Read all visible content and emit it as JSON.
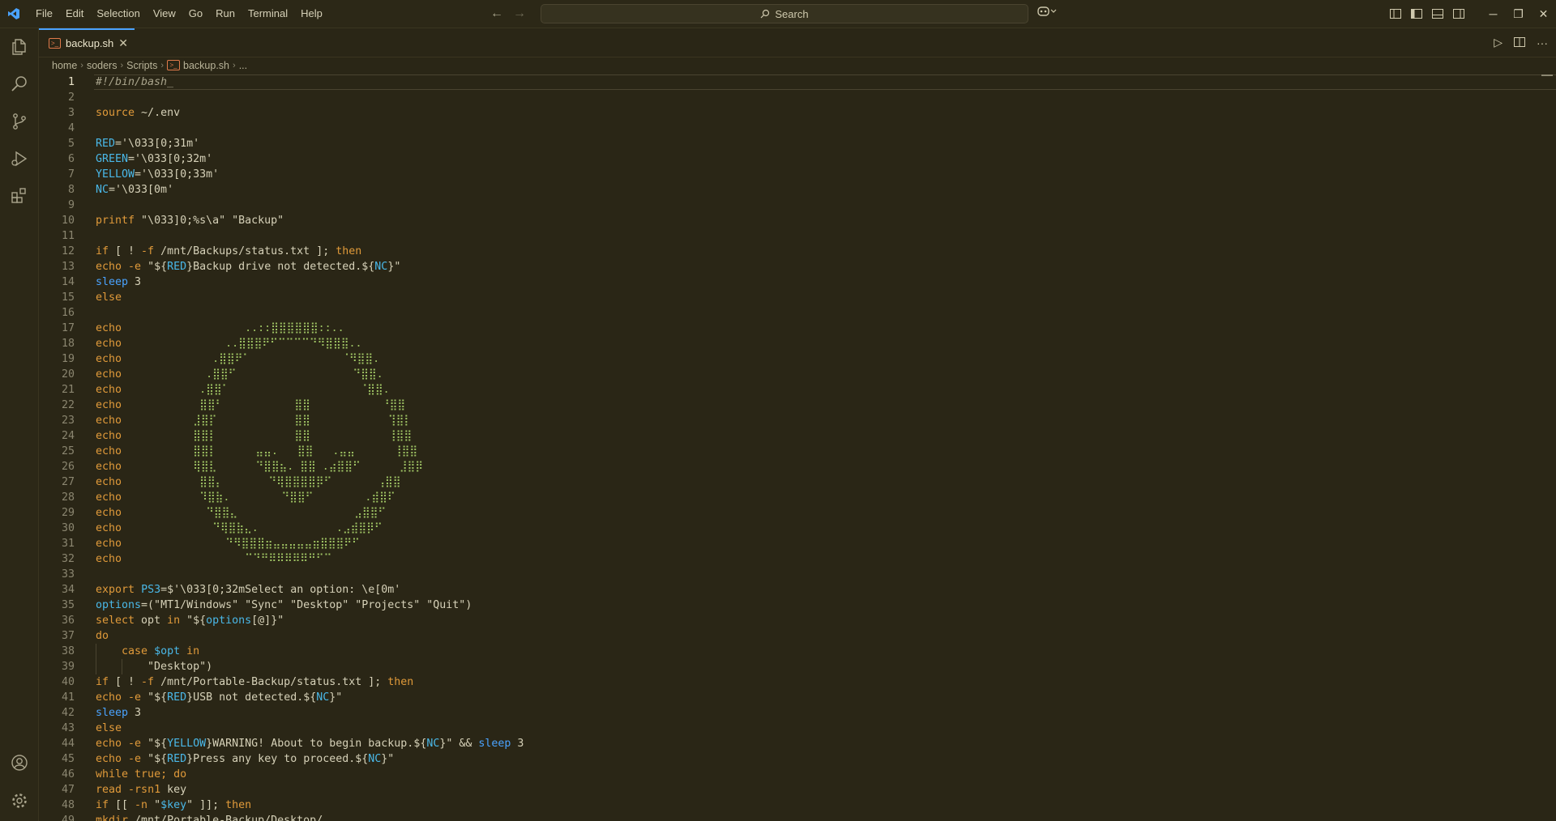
{
  "menu": [
    "File",
    "Edit",
    "Selection",
    "View",
    "Go",
    "Run",
    "Terminal",
    "Help"
  ],
  "search": {
    "label": "Search"
  },
  "tab": {
    "name": "backup.sh",
    "icon": ">_"
  },
  "breadcrumb": [
    "home",
    "soders",
    "Scripts",
    "backup.sh",
    "..."
  ],
  "colors": {
    "background": "#2a2616",
    "keyword": "#e09a3a",
    "variable": "#4ab8e8",
    "art": "#9ec263",
    "accent": "#4aa3ff"
  },
  "lines": [
    {
      "n": "1",
      "code": "#!/bin/bash_",
      "kind": "comment"
    },
    {
      "n": "2",
      "code": ""
    },
    {
      "n": "3",
      "code": "source ~/.env"
    },
    {
      "n": "4",
      "code": ""
    },
    {
      "n": "5",
      "code": "RED='\\033[0;31m'"
    },
    {
      "n": "6",
      "code": "GREEN='\\033[0;32m'"
    },
    {
      "n": "7",
      "code": "YELLOW='\\033[0;33m'"
    },
    {
      "n": "8",
      "code": "NC='\\033[0m'"
    },
    {
      "n": "9",
      "code": ""
    },
    {
      "n": "10",
      "code": "printf \"\\033]0;%s\\a\" \"Backup\""
    },
    {
      "n": "11",
      "code": ""
    },
    {
      "n": "12",
      "code": "if [ ! -f /mnt/Backups/status.txt ]; then"
    },
    {
      "n": "13",
      "code": "echo -e \"${RED}Backup drive not detected.${NC}\""
    },
    {
      "n": "14",
      "code": "sleep 3"
    },
    {
      "n": "15",
      "code": "else"
    },
    {
      "n": "16",
      "code": ""
    },
    {
      "n": "17",
      "code": "echo                   ..::⣿⣿⣿⣿⣿⣿::.."
    },
    {
      "n": "18",
      "code": "echo                ..⣿⣿⣿⠟⠋⠉⠉⠉⠉⠙⠻⣿⣿⣿.."
    },
    {
      "n": "19",
      "code": "echo              .⣿⣿⠟⠁              ⠈⠻⣿⣿."
    },
    {
      "n": "20",
      "code": "echo             .⣿⣿⠋                  ⠙⣿⣿."
    },
    {
      "n": "21",
      "code": "echo            .⣿⣿⠁                    ⠈⣿⣿."
    },
    {
      "n": "22",
      "code": "echo            ⣿⣿⠃           ⣿⣿           ⠘⣿⣿"
    },
    {
      "n": "23",
      "code": "echo           ⣸⣿⡏            ⣿⣿            ⢹⣿⡇"
    },
    {
      "n": "24",
      "code": "echo           ⣿⣿⡇            ⣿⣿            ⢸⣿⣿"
    },
    {
      "n": "25",
      "code": "echo           ⣿⣿⡇      ⣤⣤.   ⣿⣿   .⣤⣤      ⢸⣿⣿"
    },
    {
      "n": "26",
      "code": "echo           ⢿⣿⣇      ⠙⣿⣿⣦. ⣿⣿ .⣴⣿⣿⠋      ⣸⣿⡿"
    },
    {
      "n": "27",
      "code": "echo            ⣿⣿⡄       ⠙⢿⣿⣿⣿⣿⡿⠋       ⢠⣿⣿"
    },
    {
      "n": "28",
      "code": "echo            ⠹⣿⣷.        ⠙⣿⣿⠋        .⣾⣿⠏"
    },
    {
      "n": "29",
      "code": "echo             ⠙⣿⣿⣄                  ⣠⣿⣿⠋"
    },
    {
      "n": "30",
      "code": "echo              ⠙⢿⣿⣷⣄.            .⣠⣾⣿⡿⠋"
    },
    {
      "n": "31",
      "code": "echo                ⠙⠻⣿⣿⣿⣶⣤⣤⣤⣤⣤⣶⣿⣿⣿⠟⠋"
    },
    {
      "n": "32",
      "code": "echo                   ⠉⠙⠛⠿⠿⠿⠿⠿⠛⠋⠉"
    },
    {
      "n": "33",
      "code": ""
    },
    {
      "n": "34",
      "code": "export PS3=$'\\033[0;32mSelect an option: \\e[0m'"
    },
    {
      "n": "35",
      "code": "options=(\"MT1/Windows\" \"Sync\" \"Desktop\" \"Projects\" \"Quit\")"
    },
    {
      "n": "36",
      "code": "select opt in \"${options[@]}\""
    },
    {
      "n": "37",
      "code": "do"
    },
    {
      "n": "38",
      "code": "    case $opt in"
    },
    {
      "n": "39",
      "code": "        \"Desktop\")"
    },
    {
      "n": "40",
      "code": "if [ ! -f /mnt/Portable-Backup/status.txt ]; then"
    },
    {
      "n": "41",
      "code": "echo -e \"${RED}USB not detected.${NC}\""
    },
    {
      "n": "42",
      "code": "sleep 3"
    },
    {
      "n": "43",
      "code": "else"
    },
    {
      "n": "44",
      "code": "echo -e \"${YELLOW}WARNING! About to begin backup.${NC}\" && sleep 3"
    },
    {
      "n": "45",
      "code": "echo -e \"${RED}Press any key to proceed.${NC}\""
    },
    {
      "n": "46",
      "code": "while true; do"
    },
    {
      "n": "47",
      "code": "read -rsn1 key"
    },
    {
      "n": "48",
      "code": "if [[ -n \"$key\" ]]; then"
    },
    {
      "n": "49",
      "code": "mkdir /mnt/Portable-Backup/Desktop/"
    }
  ]
}
